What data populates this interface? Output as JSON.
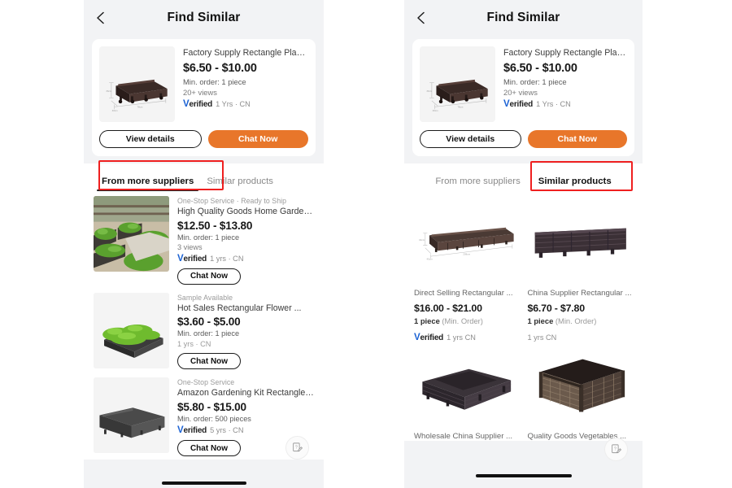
{
  "accent": {
    "orange": "#e8762a",
    "verified_blue": "#1b62d4",
    "highlight_red": "#ef2020",
    "panel_bg": "#f2f3f5",
    "card_bg": "#ffffff"
  },
  "panels": [
    {
      "id": "left",
      "header": {
        "title": "Find Similar",
        "back_icon": "chevron-left-icon"
      },
      "featured_product": {
        "title": "Factory Supply Rectangle Plantin...",
        "price": "$6.50 - $10.00",
        "min_order": "Min. order: 1 piece",
        "views": "20+ views",
        "verified_label": "Verified",
        "verified_prefix": "V",
        "verified_rest": "erified",
        "supplier_meta": "1 Yrs · CN",
        "buttons": {
          "details": "View details",
          "chat": "Chat Now"
        }
      },
      "tabs": [
        {
          "label": "From more suppliers",
          "active": true,
          "highlighted": true
        },
        {
          "label": "Similar products",
          "active": false,
          "highlighted": false
        }
      ],
      "list": [
        {
          "tagline": "One-Stop Service · Ready to Ship",
          "title": "High Quality Goods Home Garden...",
          "price": "$12.50 - $13.80",
          "min_order": "Min. order: 1 piece",
          "views": "3 views",
          "verified": true,
          "verified_prefix": "V",
          "verified_rest": "erified",
          "supplier_meta": "1 yrs · CN",
          "chat_label": "Chat Now"
        },
        {
          "tagline": "Sample Available",
          "title": "Hot Sales Rectangular Flower ...",
          "price": "$3.60 - $5.00",
          "min_order": "Min. order: 1 piece",
          "views": "",
          "verified": false,
          "supplier_meta": "1 yrs · CN",
          "chat_label": "Chat Now"
        },
        {
          "tagline": "One-Stop Service",
          "title": "Amazon Gardening Kit Rectangle ...",
          "price": "$5.80 - $15.00",
          "min_order": "Min. order: 500 pieces",
          "views": "",
          "verified": true,
          "verified_prefix": "V",
          "verified_rest": "erified",
          "supplier_meta": "5 yrs · CN",
          "chat_label": "Chat Now"
        }
      ],
      "feedback_icon": "feedback-survey-icon"
    },
    {
      "id": "right",
      "header": {
        "title": "Find Similar",
        "back_icon": "chevron-left-icon"
      },
      "featured_product": {
        "title": "Factory Supply Rectangle Plantin...",
        "price": "$6.50 - $10.00",
        "min_order": "Min. order: 1 piece",
        "views": "20+ views",
        "verified_label": "Verified",
        "verified_prefix": "V",
        "verified_rest": "erified",
        "supplier_meta": "1 Yrs · CN",
        "buttons": {
          "details": "View details",
          "chat": "Chat Now"
        }
      },
      "tabs": [
        {
          "label": "From more suppliers",
          "active": false,
          "highlighted": false
        },
        {
          "label": "Similar products",
          "active": true,
          "highlighted": true
        }
      ],
      "grid": [
        {
          "title": "Direct Selling Rectangular ...",
          "price": "$16.00 - $21.00",
          "moq_bold": "1 piece",
          "moq_rest": "(Min. Order)",
          "verified": true,
          "verified_prefix": "V",
          "verified_rest": "erified",
          "supplier_meta": "1 yrs CN"
        },
        {
          "title": "China Supplier Rectangular ...",
          "price": "$6.70 - $7.80",
          "moq_bold": "1 piece",
          "moq_rest": "(Min. Order)",
          "verified": false,
          "supplier_meta": "1 yrs CN"
        },
        {
          "title": "Wholesale China Supplier ...",
          "price": "",
          "moq_bold": "",
          "moq_rest": "",
          "verified": false,
          "supplier_meta": ""
        },
        {
          "title": "Quality Goods Vegetables ...",
          "price": "",
          "moq_bold": "",
          "moq_rest": "",
          "verified": false,
          "supplier_meta": ""
        }
      ],
      "feedback_icon": "feedback-survey-icon"
    }
  ]
}
